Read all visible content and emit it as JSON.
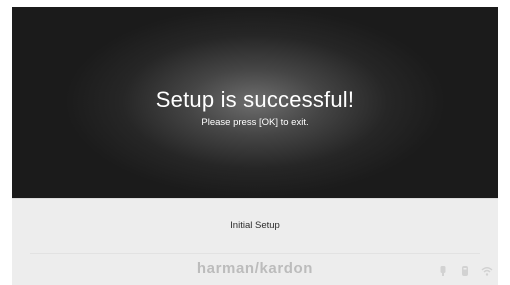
{
  "dialog": {
    "title": "Setup is successful!",
    "instruction": "Please press [OK] to exit."
  },
  "footer": {
    "section_label": "Initial Setup",
    "brand": "harman/kardon"
  },
  "status_icons": [
    "usb-icon",
    "media-icon",
    "wifi-icon"
  ],
  "colors": {
    "screen_background": "#1b1b1b",
    "panel_background": "#ededed",
    "brand_gray": "#bcbcbc"
  }
}
